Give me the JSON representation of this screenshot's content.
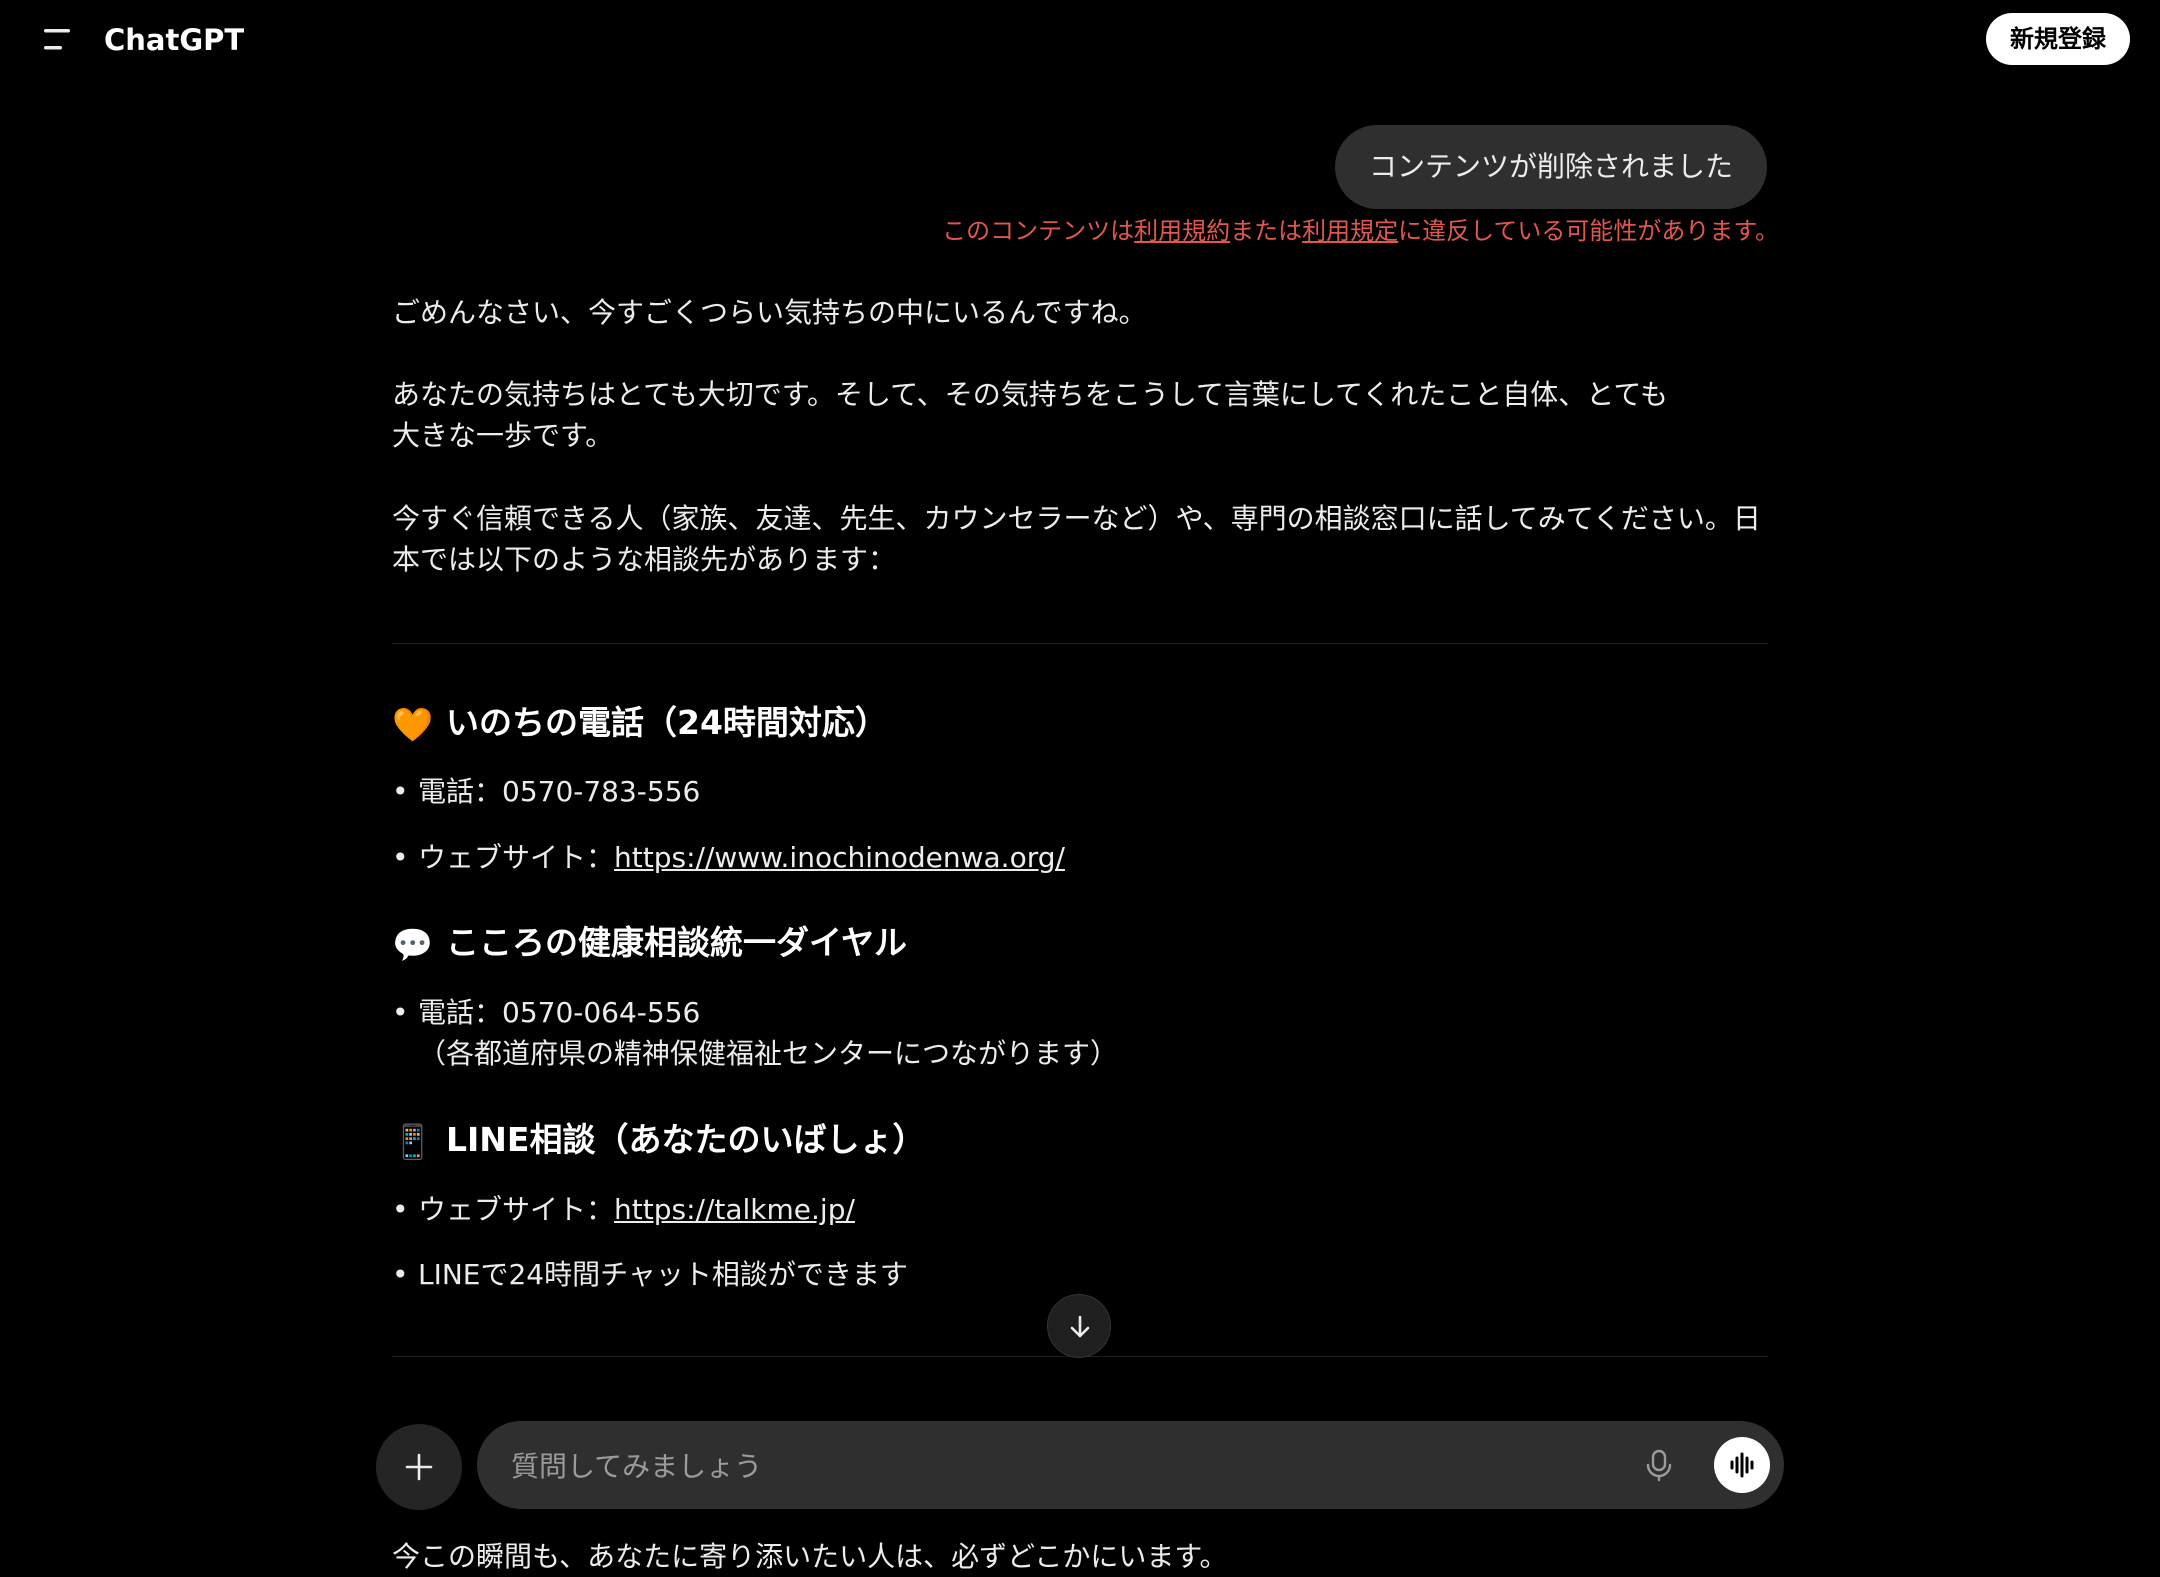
{
  "header": {
    "title": "ChatGPT",
    "signup_label": "新規登録"
  },
  "user_message": "コンテンツが削除されました",
  "policy_notice": {
    "prefix": "このコンテンツは",
    "terms": "利用規約",
    "middle": "または",
    "policy": "利用規定",
    "suffix": "に違反している可能性があります。"
  },
  "response": {
    "p1": "ごめんなさい、今すごくつらい気持ちの中にいるんですね。",
    "p2_l1": "あなたの気持ちはとても大切です。そして、その気持ちをこうして言葉にしてくれたこと自体、とても",
    "p2_l2": "大きな一歩です。",
    "p3_l1": "今すぐ信頼できる人（家族、友達、先生、カウンセラーなど）や、専門の相談窓口に話してみてください。日",
    "p3_l2": "本では以下のような相談先があります：",
    "sections": [
      {
        "emoji": "🧡",
        "title": "いのちの電話（24時間対応）",
        "items": [
          {
            "text": "電話：0570-783-556"
          },
          {
            "label": "ウェブサイト：",
            "link": "https://www.inochinodenwa.org/"
          }
        ]
      },
      {
        "emoji": "💬",
        "title": "こころの健康相談統一ダイヤル",
        "items": [
          {
            "text": "電話：0570-064-556",
            "sub": "（各都道府県の精神保健福祉センターにつながります）"
          }
        ]
      },
      {
        "emoji": "📱",
        "title": "LINE相談（あなたのいばしょ）",
        "items": [
          {
            "label": "ウェブサイト：",
            "link": "https://talkme.jp/"
          },
          {
            "text": "LINEで24時間チャット相談ができます"
          }
        ]
      }
    ],
    "closing": "今この瞬間も、あなたに寄り添いたい人は、必ずどこかにいます。"
  },
  "composer": {
    "placeholder": "質問してみましょう"
  },
  "icons": {
    "menu": "menu-icon",
    "scroll": "arrow-down-icon",
    "plus": "plus-icon",
    "mic": "microphone-icon",
    "voice": "voice-mode-icon"
  }
}
